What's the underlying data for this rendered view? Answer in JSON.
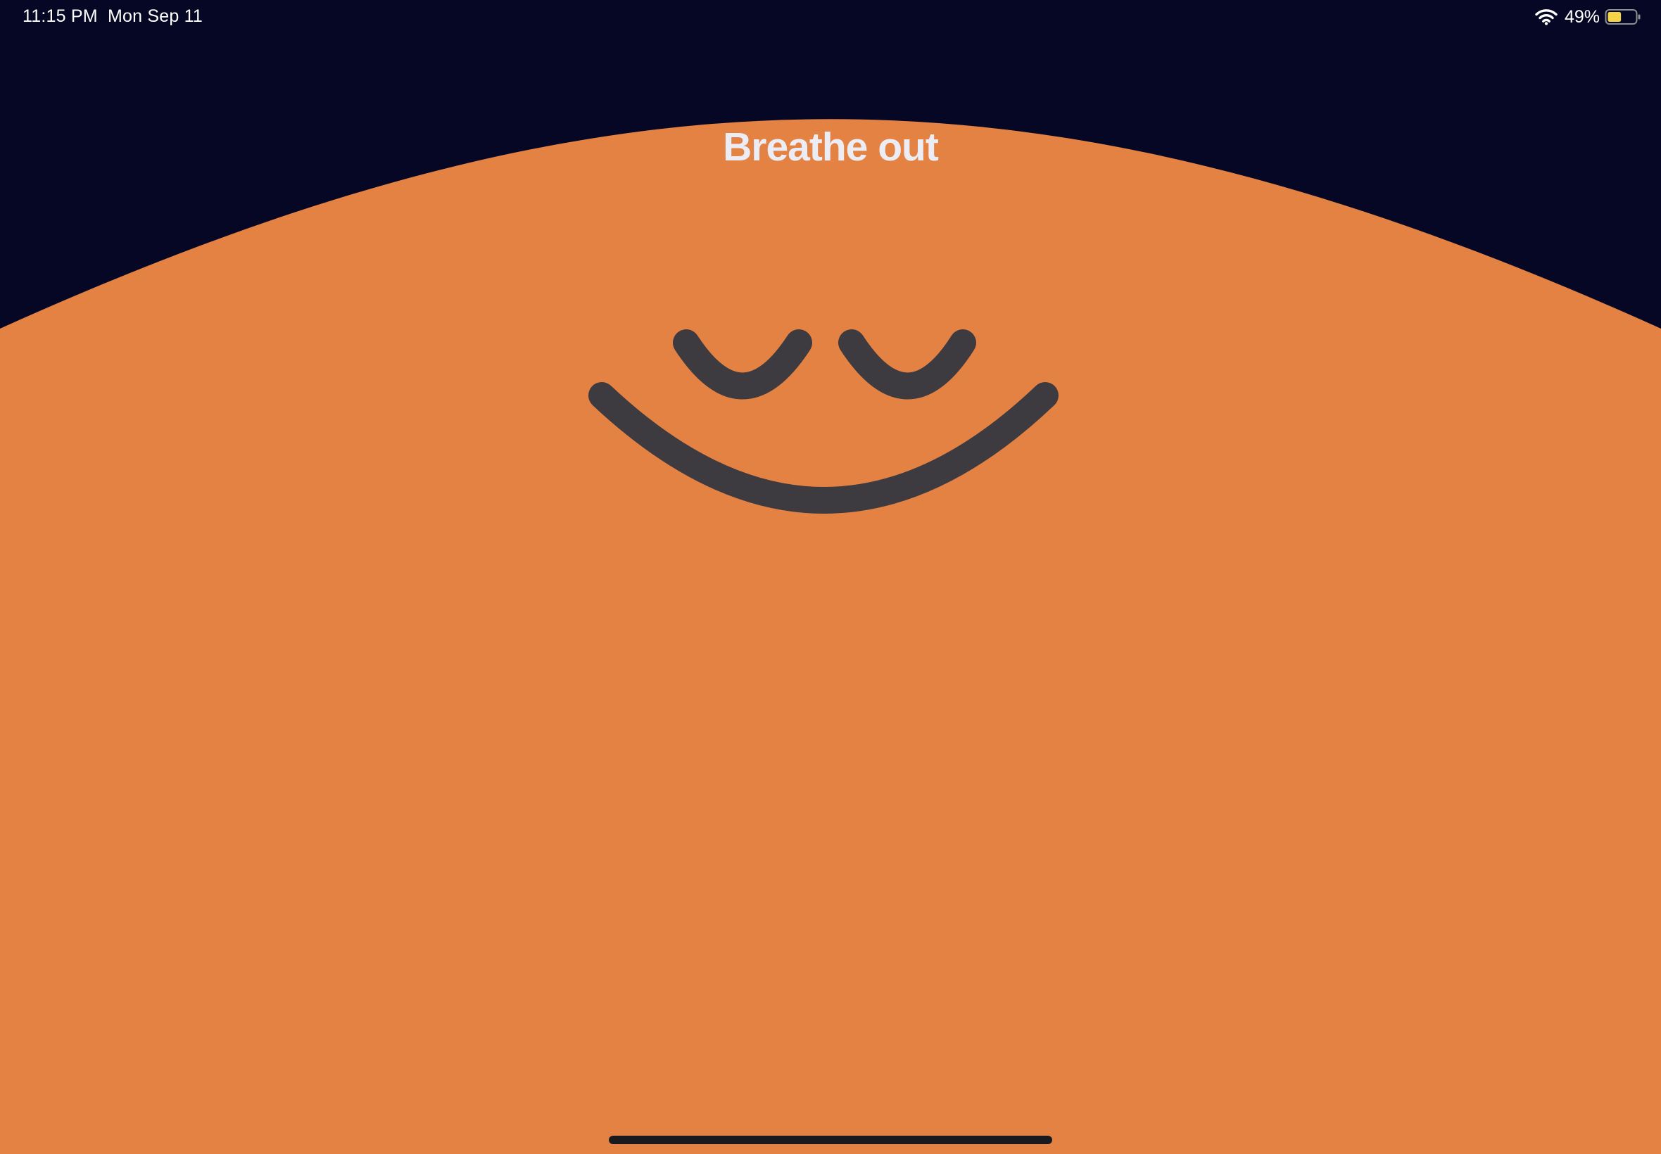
{
  "status_bar": {
    "time": "11:15 PM",
    "date": "Mon Sep 11",
    "battery_percent": "49%",
    "battery_level": 0.49,
    "wifi_icon": "wifi-icon",
    "battery_icon": "battery-icon"
  },
  "breathing": {
    "prompt": "Breathe out"
  },
  "colors": {
    "background": "#050724",
    "character_body": "#E48244",
    "face_features": "#3D3A40",
    "prompt_text": "#ECECF4",
    "battery_fill": "#F5D547"
  },
  "character": {
    "name": "smiling-character-face",
    "expression": "eyes-closed-smile"
  }
}
